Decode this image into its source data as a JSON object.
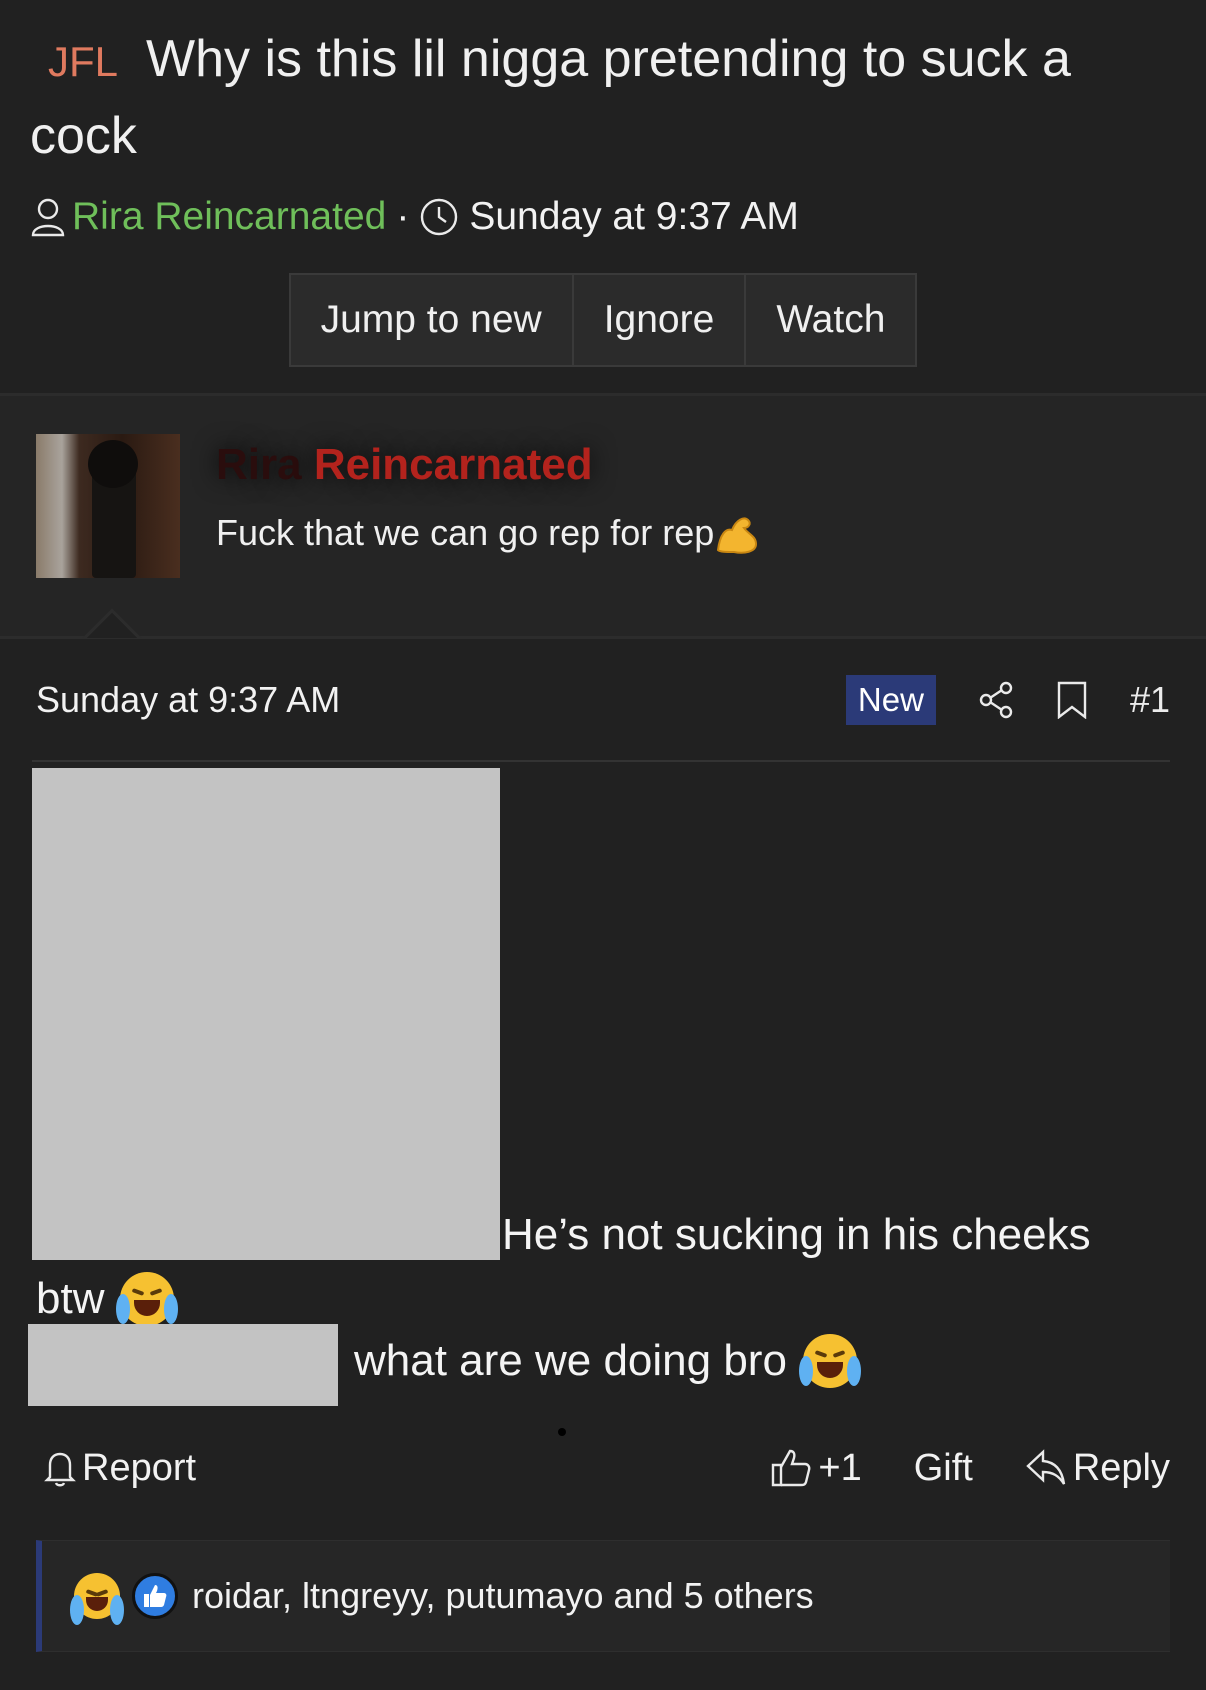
{
  "thread": {
    "prefix": "JFL",
    "title": "Why is this lil nigga pretending to suck a cock",
    "author": "Rira Reincarnated",
    "separator": "·",
    "date": "Sunday at 9:37 AM"
  },
  "thread_buttons": {
    "jump": "Jump to new",
    "ignore": "Ignore",
    "watch": "Watch"
  },
  "post": {
    "username_first": "Rira",
    "username_last": "Reincarnated",
    "user_title": "Fuck that we can go rep for rep",
    "date": "Sunday at 9:37 AM",
    "badge": "New",
    "number": "#1",
    "body_line1": "He’s not sucking in his cheeks",
    "body_line2": "btw",
    "body_line3": "what are we doing bro"
  },
  "actions": {
    "report": "Report",
    "like": "+1",
    "gift": "Gift",
    "reply": "Reply"
  },
  "reactions": {
    "summary": "roidar, ltngreyy, putumayo and 5 others"
  },
  "colors": {
    "background": "#212121",
    "author_green": "#6fbf5a",
    "prefix_orange": "#e07a5f",
    "username_red": "#b3231d",
    "badge_blue": "#2b3a78"
  },
  "icons": [
    "user-icon",
    "clock-icon",
    "flexed-bicep-icon",
    "share-icon",
    "bookmark-icon",
    "bell-icon",
    "thumbs-up-icon",
    "reply-icon",
    "laughing-crying-emoji",
    "like-reaction-icon"
  ]
}
